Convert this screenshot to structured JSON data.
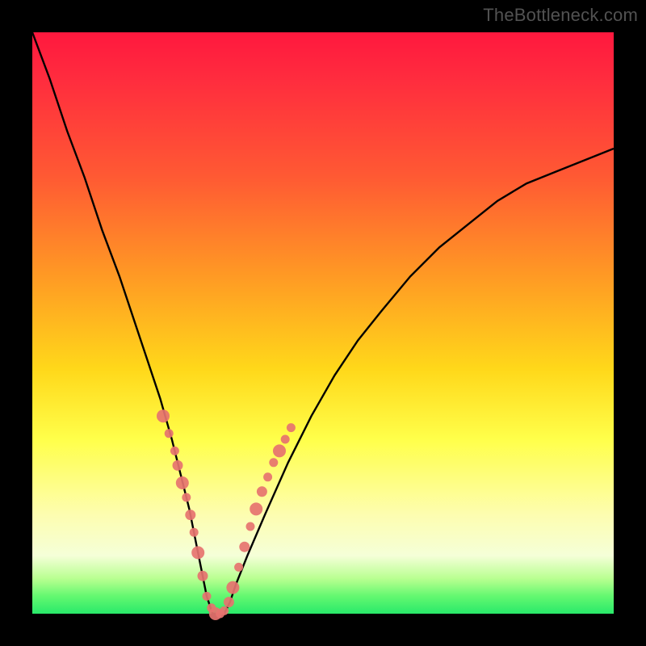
{
  "watermark": "TheBottleneck.com",
  "colors": {
    "background": "#000000",
    "curve": "#000000",
    "marker": "#e6736f",
    "gradient_top": "#ff183e",
    "gradient_bottom": "#29e96a"
  },
  "chart_data": {
    "type": "line",
    "title": "",
    "xlabel": "",
    "ylabel": "",
    "xlim": [
      0,
      100
    ],
    "ylim": [
      0,
      100
    ],
    "grid": false,
    "legend": false,
    "note": "No numeric axis labels are visible in the source image; x and y values below are normalized 0–100 readings of the curve's screen position (0 = left/bottom, 100 = right/top). Series 'curve' is the main black V-shaped line; 'markers' is the set of salmon/pink dots overlaid near the trough.",
    "series": [
      {
        "name": "curve",
        "x": [
          0,
          3,
          6,
          9,
          12,
          15,
          18,
          20,
          22,
          24,
          25,
          26,
          27,
          28,
          29,
          30,
          31,
          32,
          33,
          34,
          35,
          37,
          40,
          44,
          48,
          52,
          56,
          60,
          65,
          70,
          75,
          80,
          85,
          90,
          95,
          100
        ],
        "y": [
          100,
          92,
          83,
          75,
          66,
          58,
          49,
          43,
          37,
          30,
          26,
          22,
          18,
          13,
          8,
          3,
          0,
          0,
          0,
          2,
          5,
          10,
          17,
          26,
          34,
          41,
          47,
          52,
          58,
          63,
          67,
          71,
          74,
          76,
          78,
          80
        ]
      },
      {
        "name": "markers",
        "x": [
          22.5,
          23.5,
          24.5,
          25.0,
          25.8,
          26.5,
          27.2,
          27.8,
          28.5,
          29.3,
          30.0,
          30.8,
          31.5,
          32.3,
          33.0,
          33.8,
          34.5,
          35.5,
          36.5,
          37.5,
          38.5,
          39.5,
          40.5,
          41.5,
          42.5,
          43.5,
          44.5
        ],
        "y": [
          34.0,
          31.0,
          28.0,
          25.5,
          22.5,
          20.0,
          17.0,
          14.0,
          10.5,
          6.5,
          3.0,
          1.0,
          0.0,
          0.0,
          0.5,
          2.0,
          4.5,
          8.0,
          11.5,
          15.0,
          18.0,
          21.0,
          23.5,
          26.0,
          28.0,
          30.0,
          32.0
        ]
      }
    ]
  }
}
